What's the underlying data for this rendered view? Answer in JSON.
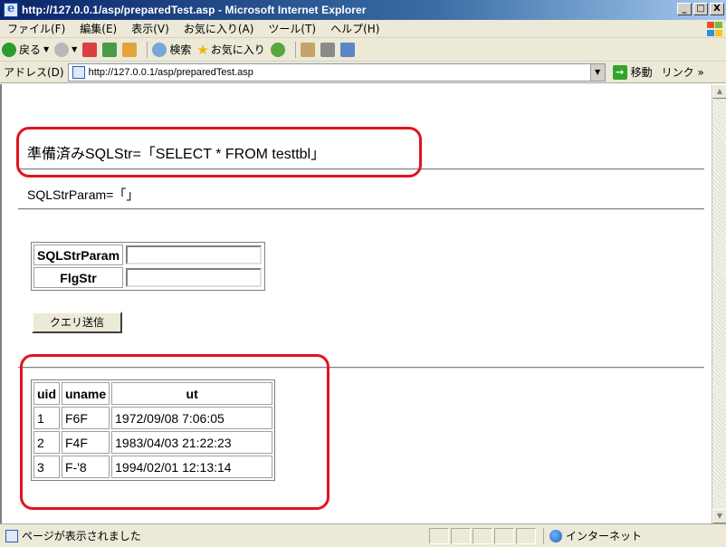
{
  "window": {
    "title": "http://127.0.0.1/asp/preparedTest.asp - Microsoft Internet Explorer",
    "minimize": "_",
    "maximize": "□",
    "close": "X"
  },
  "menu": {
    "items": [
      "ファイル(F)",
      "編集(E)",
      "表示(V)",
      "お気に入り(A)",
      "ツール(T)",
      "ヘルプ(H)"
    ]
  },
  "toolbar": {
    "back_label": "戻る",
    "search_label": "検索",
    "favorites_label": "お気に入り"
  },
  "address": {
    "label": "アドレス(D)",
    "url": "http://127.0.0.1/asp/preparedTest.asp",
    "go_label": "移動",
    "links_label": "リンク »"
  },
  "page": {
    "prepared_line": "準備済みSQLStr=「SELECT * FROM testtbl」",
    "param_line": "SQLStrParam=「」",
    "form": {
      "field1_label": "SQLStrParam",
      "field1_value": "",
      "field2_label": "FlgStr",
      "field2_value": "",
      "submit_label": "クエリ送信"
    },
    "results": {
      "headers": [
        "uid",
        "uname",
        "ut"
      ],
      "rows": [
        [
          "1",
          "F6F",
          "1972/09/08 7:06:05"
        ],
        [
          "2",
          "F4F",
          "1983/04/03 21:22:23"
        ],
        [
          "3",
          "F-'8",
          "1994/02/01 12:13:14"
        ]
      ]
    }
  },
  "status": {
    "text": "ページが表示されました",
    "zone": "インターネット"
  },
  "colors": {
    "highlight": "#e0141e",
    "titlebar": "#0a246a",
    "chrome": "#ece9d8"
  }
}
